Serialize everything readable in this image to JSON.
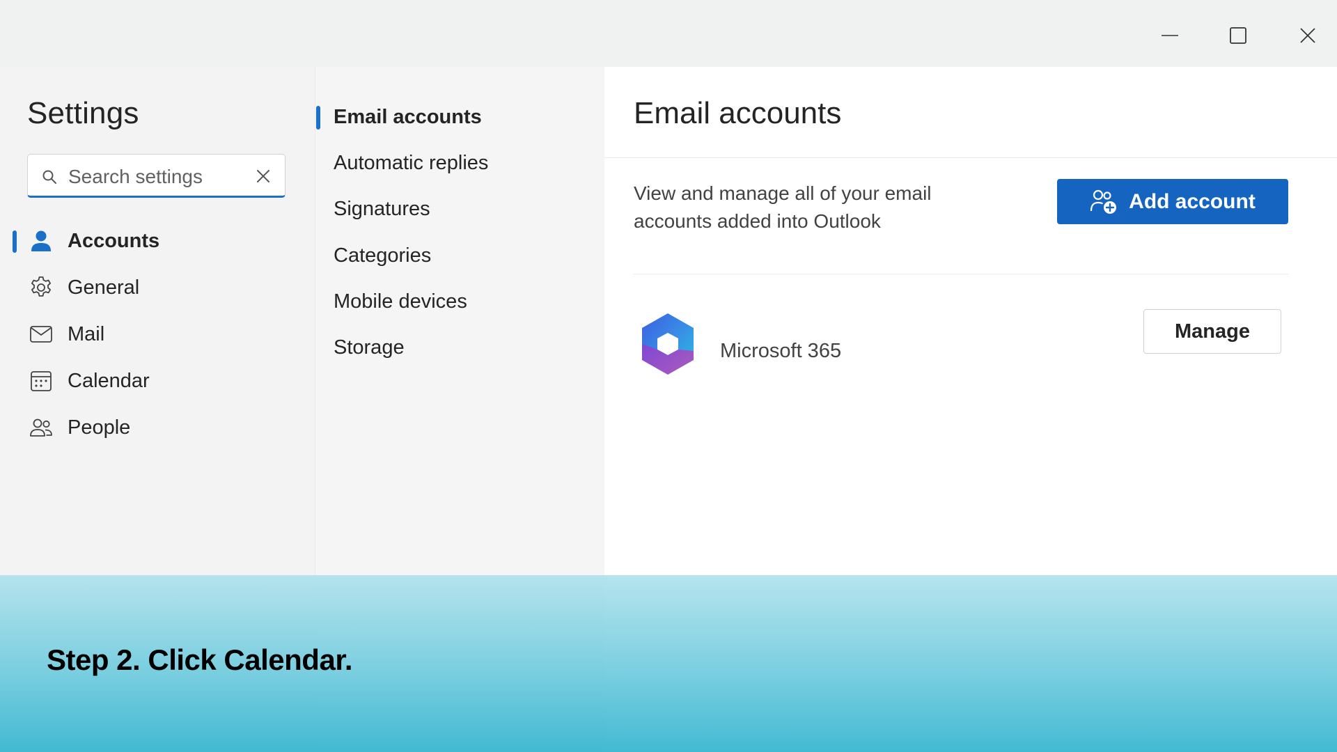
{
  "window": {
    "controls": [
      "minimize-icon",
      "maximize-icon",
      "close-icon"
    ]
  },
  "settings": {
    "title": "Settings",
    "search": {
      "placeholder": "Search settings"
    },
    "nav": [
      {
        "label": "Accounts",
        "icon": "person-icon",
        "active": true
      },
      {
        "label": "General",
        "icon": "gear-icon",
        "active": false
      },
      {
        "label": "Mail",
        "icon": "mail-icon",
        "active": false
      },
      {
        "label": "Calendar",
        "icon": "calendar-icon",
        "active": false
      },
      {
        "label": "People",
        "icon": "people-icon",
        "active": false
      }
    ]
  },
  "accounts_menu": {
    "items": [
      {
        "label": "Email accounts",
        "active": true
      },
      {
        "label": "Automatic replies",
        "active": false
      },
      {
        "label": "Signatures",
        "active": false
      },
      {
        "label": "Categories",
        "active": false
      },
      {
        "label": "Mobile devices",
        "active": false
      },
      {
        "label": "Storage",
        "active": false
      }
    ]
  },
  "email_accounts": {
    "title": "Email accounts",
    "description": "View and manage all of your email accounts added into Outlook",
    "add_button": "Add account",
    "account": {
      "name": "Microsoft 365",
      "logo": "microsoft-365-logo"
    },
    "manage_button": "Manage"
  },
  "tutorial": {
    "caption": "Step 2. Click Calendar."
  },
  "colors": {
    "accent": "#1464c0",
    "overlay_top": "#b0e2ec",
    "overlay_bottom": "#39b6d0"
  }
}
